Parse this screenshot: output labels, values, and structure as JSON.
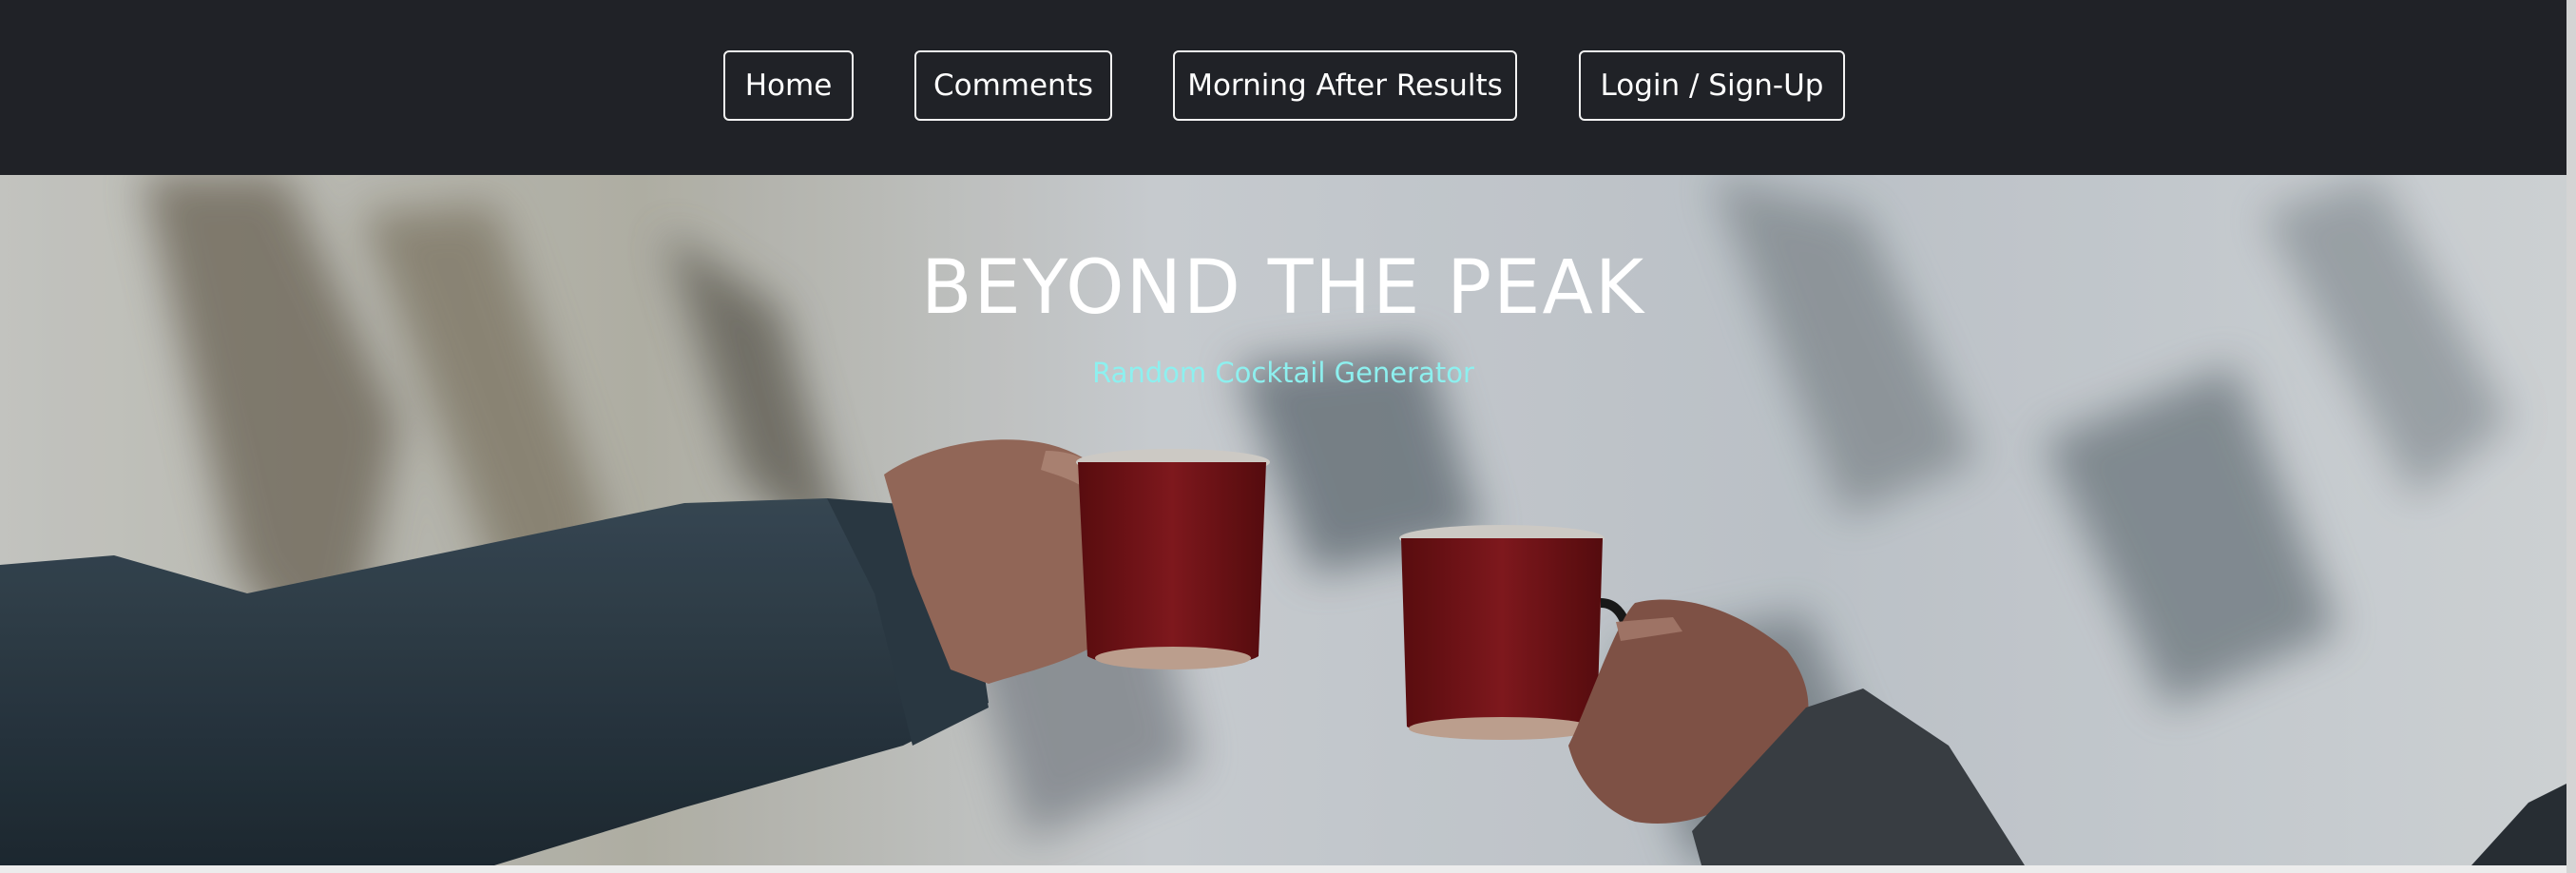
{
  "nav": {
    "home_label": "Home",
    "comments_label": "Comments",
    "morning_label": "Morning After Results",
    "login_label": "Login / Sign-Up"
  },
  "hero": {
    "title": "BEYOND THE PEAK",
    "subtitle": "Random Cocktail Generator"
  },
  "colors": {
    "navbar_bg": "#202227",
    "subtitle": "#8df0ef",
    "mug_red": "#7a1418"
  }
}
